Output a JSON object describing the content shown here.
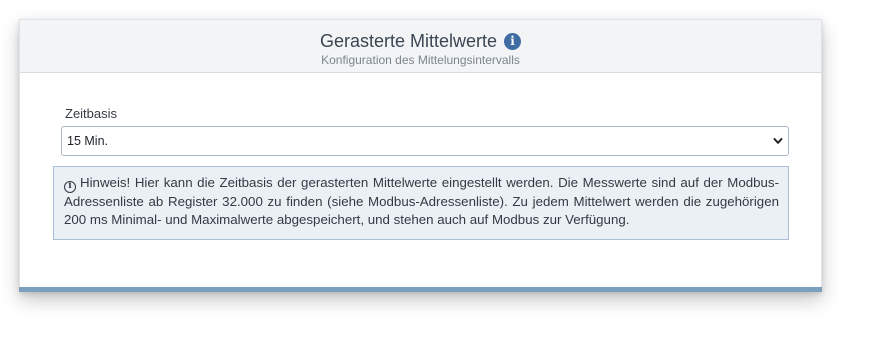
{
  "header": {
    "title": "Gerasterte Mittelwerte",
    "info_icon": "info-circle-icon",
    "info_glyph": "i",
    "subtitle": "Konfiguration des Mittelungsintervalls"
  },
  "form": {
    "timebase_label": "Zeitbasis",
    "timebase_value": "15 Min.",
    "dropdown_icon": "chevron-down-icon"
  },
  "hint": {
    "icon": "info-circle-outline-icon",
    "icon_glyph": "i",
    "text": "Hinweis! Hier kann die Zeitbasis der gerasterten Mittelwerte eingestellt werden. Die Messwerte sind auf der Modbus-Adressenliste ab Register 32.000 zu finden (siehe Modbus-Adressenliste). Zu jedem Mittelwert werden die zugehörigen 200 ms Minimal- und Maximalwerte abgespeichert, und stehen auch auf Modbus zur Verfügung."
  },
  "colors": {
    "accent": "#3f6da2",
    "header_bg": "#f2f4f6",
    "hint_bg": "#ebf0f5",
    "hint_border": "#a9bed4",
    "footer_bar": "#7d9fbe"
  }
}
